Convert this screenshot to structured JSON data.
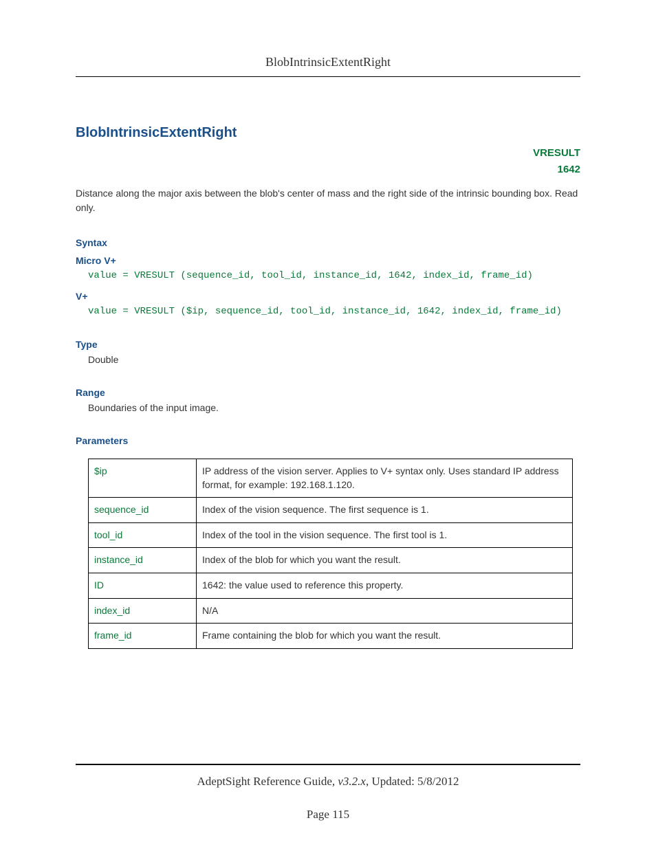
{
  "header": {
    "title": "BlobIntrinsicExtentRight"
  },
  "main": {
    "title": "BlobIntrinsicExtentRight",
    "badge_label": "VRESULT",
    "badge_code": "1642",
    "description": "Distance along the major axis between the blob's center of mass and the right side of the intrinsic bounding box. Read only."
  },
  "syntax": {
    "heading": "Syntax",
    "micro": {
      "label": "Micro V+",
      "code": "value = VRESULT (sequence_id, tool_id, instance_id, 1642, index_id, frame_id)"
    },
    "vplus": {
      "label": "V+",
      "code": "value = VRESULT ($ip, sequence_id, tool_id, instance_id, 1642, index_id, frame_id)"
    }
  },
  "type": {
    "heading": "Type",
    "value": "Double"
  },
  "range": {
    "heading": "Range",
    "value": "Boundaries of the input image."
  },
  "parameters": {
    "heading": "Parameters",
    "rows": [
      {
        "name": "$ip",
        "desc": "IP address of the vision server. Applies to V+ syntax only. Uses standard IP address format, for example: 192.168.1.120."
      },
      {
        "name": "sequence_id",
        "desc": "Index of the vision sequence. The first sequence is 1."
      },
      {
        "name": "tool_id",
        "desc": "Index of the tool in the vision sequence. The first tool is 1."
      },
      {
        "name": "instance_id",
        "desc": "Index of the blob for which you want the result."
      },
      {
        "name": "ID",
        "desc": "1642: the value used to reference this property."
      },
      {
        "name": "index_id",
        "desc": "N/A"
      },
      {
        "name": "frame_id",
        "desc": "Frame containing the blob for which you want the result."
      }
    ]
  },
  "footer": {
    "guide": "AdeptSight Reference Guide",
    "version": ", v3.2.x",
    "updated": ", Updated: 5/8/2012",
    "page": "Page 115"
  }
}
